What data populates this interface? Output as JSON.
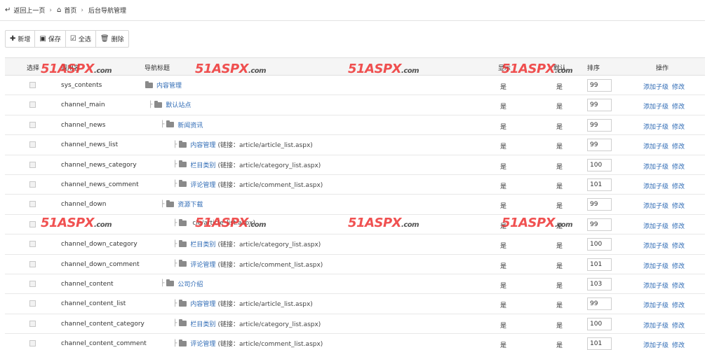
{
  "breadcrumb": {
    "back": "返回上一页",
    "home": "首页",
    "current": "后台导航管理"
  },
  "toolbar": {
    "add": "新增",
    "save": "保存",
    "select_all": "全选",
    "delete": "删除"
  },
  "columns": {
    "select": "选择",
    "call_name": "调用名",
    "nav_title": "导航标题",
    "show": "显示",
    "default": "默认",
    "sort": "排序",
    "action": "操作"
  },
  "rows": [
    {
      "call": "sys_contents",
      "title": "内容管理",
      "link": "",
      "level": 0,
      "show": "是",
      "def": "是",
      "sort": "99"
    },
    {
      "call": "channel_main",
      "title": "默认站点",
      "link": "",
      "level": 1,
      "show": "是",
      "def": "是",
      "sort": "99"
    },
    {
      "call": "channel_news",
      "title": "新闻资讯",
      "link": "",
      "level": 2,
      "show": "是",
      "def": "是",
      "sort": "99"
    },
    {
      "call": "channel_news_list",
      "title": "内容管理",
      "link": "(链接：article/article_list.aspx)",
      "level": 3,
      "show": "是",
      "def": "是",
      "sort": "99"
    },
    {
      "call": "channel_news_category",
      "title": "栏目类别",
      "link": "(链接：article/category_list.aspx)",
      "level": 3,
      "show": "是",
      "def": "是",
      "sort": "100"
    },
    {
      "call": "channel_news_comment",
      "title": "评论管理",
      "link": "(链接：article/comment_list.aspx)",
      "level": 3,
      "show": "是",
      "def": "是",
      "sort": "101"
    },
    {
      "call": "channel_down",
      "title": "资源下载",
      "link": "",
      "level": 2,
      "show": "是",
      "def": "是",
      "sort": "99"
    },
    {
      "call": "",
      "title": "",
      "link": "cle/article_list.aspx)",
      "level": 3,
      "show": "是",
      "def": "是",
      "sort": "99"
    },
    {
      "call": "channel_down_category",
      "title": "栏目类别",
      "link": "(链接：article/category_list.aspx)",
      "level": 3,
      "show": "是",
      "def": "是",
      "sort": "100"
    },
    {
      "call": "channel_down_comment",
      "title": "评论管理",
      "link": "(链接：article/comment_list.aspx)",
      "level": 3,
      "show": "是",
      "def": "是",
      "sort": "101"
    },
    {
      "call": "channel_content",
      "title": "公司介绍",
      "link": "",
      "level": 2,
      "show": "是",
      "def": "是",
      "sort": "103"
    },
    {
      "call": "channel_content_list",
      "title": "内容管理",
      "link": "(链接：article/article_list.aspx)",
      "level": 3,
      "show": "是",
      "def": "是",
      "sort": "99"
    },
    {
      "call": "channel_content_category",
      "title": "栏目类别",
      "link": "(链接：article/category_list.aspx)",
      "level": 3,
      "show": "是",
      "def": "是",
      "sort": "100"
    },
    {
      "call": "channel_content_comment",
      "title": "评论管理",
      "link": "(链接：article/comment_list.aspx)",
      "level": 3,
      "show": "是",
      "def": "是",
      "sort": "101"
    }
  ],
  "ops": {
    "add_child": "添加子级",
    "edit": "修改"
  },
  "watermark": {
    "num": "51",
    "asp": "ASPX",
    "com": ".com"
  }
}
